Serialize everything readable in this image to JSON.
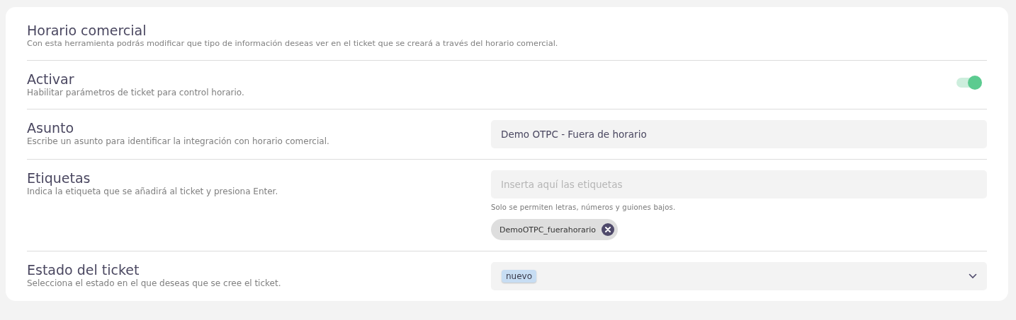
{
  "header": {
    "title": "Horario comercial",
    "description": "Con esta herramienta podrás modificar que tipo de información deseas ver en el ticket que se creará a través del horario comercial."
  },
  "rows": [
    {
      "kind": "toggle",
      "label": "Activar",
      "description": "Habilitar parámetros de ticket para control horario.",
      "on": true
    },
    {
      "kind": "text",
      "label": "Asunto",
      "description": "Escribe un asunto para identificar la integración con horario comercial.",
      "value": "Demo OTPC - Fuera de horario"
    },
    {
      "kind": "tags",
      "label": "Etiquetas",
      "description": "Indica la etiqueta que se añadirá al ticket y presiona Enter.",
      "placeholder": "Inserta aquí las etiquetas",
      "hint": "Solo se permiten letras, números y guiones bajos.",
      "tags": [
        "DemoOTPC_fuerahorario"
      ]
    },
    {
      "kind": "select",
      "label": "Estado del ticket",
      "description": "Selecciona el estado en el que deseas que se cree el ticket.",
      "value": "nuevo"
    }
  ]
}
